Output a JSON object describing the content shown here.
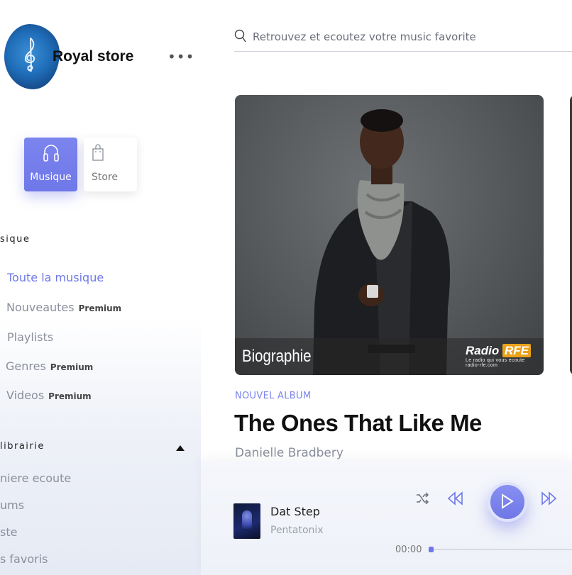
{
  "brand": {
    "name": "Royal store"
  },
  "modes": [
    {
      "label": "Musique",
      "icon": "headphones-icon",
      "active": true
    },
    {
      "label": "Store",
      "icon": "shopping-bag-icon",
      "active": false
    }
  ],
  "sidebar": {
    "music_section_title": "sique",
    "nav": [
      {
        "label": "Toute la musique",
        "badge": "",
        "active": true
      },
      {
        "label": "Nouveautes",
        "badge": "Premium",
        "active": false
      },
      {
        "label": "Playlists",
        "badge": "",
        "active": false
      },
      {
        "label": "Genres",
        "badge": "Premium",
        "active": false
      },
      {
        "label": "Videos",
        "badge": "Premium",
        "active": false
      }
    ],
    "library_section_title": "librairie",
    "library": [
      {
        "label": "niere ecoute"
      },
      {
        "label": "ums"
      },
      {
        "label": "ste"
      },
      {
        "label": "s favoris"
      }
    ]
  },
  "search": {
    "placeholder": "Retrouvez et ecoutez votre music favorite"
  },
  "featured": {
    "card_caption": "Biographie",
    "radio_logo": {
      "word": "Radio",
      "mark": "RFE",
      "tagline": "Le radio qui vous ecoute",
      "url": "radio-rfe.com"
    },
    "tag": "NOUVEL ALBUM",
    "title": "The Ones That Like Me",
    "artist": "Danielle Bradbery"
  },
  "player": {
    "track_title": "Dat Step",
    "track_artist": "Pentatonix",
    "current_time": "00:00",
    "progress": 0.0
  },
  "colors": {
    "accent": "#6f78e8",
    "text_muted": "#8a8f9c"
  }
}
